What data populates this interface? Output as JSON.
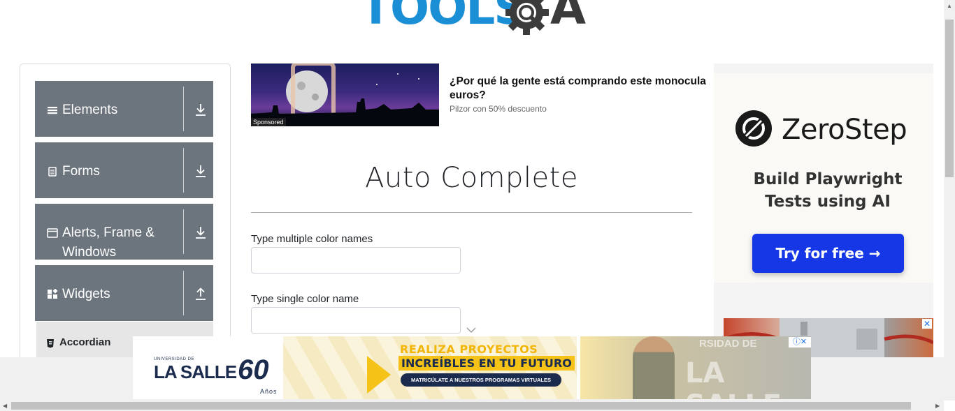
{
  "logo": {
    "text_tools": "TOOLS",
    "text_a": "A",
    "icon": "gear-magnifier-icon"
  },
  "sidebar": {
    "groups": [
      {
        "label": "Elements",
        "icon": "hamburger-icon",
        "toggle_icon": "download-arrow-icon"
      },
      {
        "label": "Forms",
        "icon": "document-icon",
        "toggle_icon": "download-arrow-icon"
      },
      {
        "label": "Alerts, Frame & Windows",
        "icon": "window-icon",
        "toggle_icon": "download-arrow-icon"
      },
      {
        "label": "Widgets",
        "icon": "widgets-icon",
        "toggle_icon": "upload-arrow-icon"
      }
    ],
    "active_subitem": {
      "label": "Accordian",
      "icon": "html5-icon"
    }
  },
  "sponsored": {
    "tag": "Sponsored",
    "title": "¿Por qué la gente está comprando este monocular? ... euros?",
    "title_line1": "¿Por qué la gente está comprando este monocula",
    "title_line2": "euros?",
    "subtitle": "Pilzor con 50% descuento"
  },
  "main": {
    "title": "Auto Complete",
    "fields": [
      {
        "label": "Type multiple color names",
        "value": ""
      },
      {
        "label": "Type single color name",
        "value": ""
      }
    ]
  },
  "right_ad": {
    "brand": "ZeroStep",
    "headline_line1": "Build Playwright",
    "headline_line2": "Tests using AI",
    "cta": "Try for free →",
    "close": "✕"
  },
  "bottom_ad": {
    "logo_small": "UNIVERSIDAD DE",
    "logo_big": "LA SALLE",
    "logo_years": "60",
    "logo_anos": "Años",
    "headline_1": "REALIZA PROYECTOS",
    "headline_2": "INCREÍBLES EN TU FUTURO",
    "cta": "MATRICÚLATE A NUESTROS PROGRAMAS VIRTUALES",
    "watermark_small": "RSIDAD DE",
    "watermark": "LA SALLE",
    "adchoice": "ⓘ✕"
  },
  "colors": {
    "sidebar_group_bg": "#6c757d",
    "logo_blue": "#1a8fd6",
    "cta_blue": "#1537e6",
    "banner_yellow": "#f5c217",
    "banner_navy": "#1b2b4d"
  }
}
